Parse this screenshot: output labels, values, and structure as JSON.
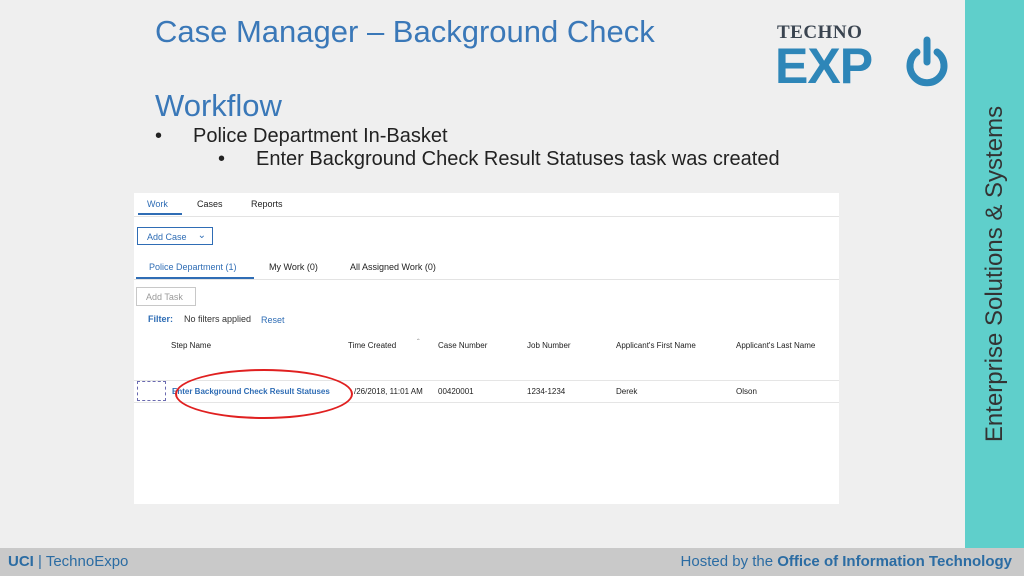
{
  "slide": {
    "title": "Case Manager – Background Check",
    "section": "Workflow",
    "bullet1": "Police Department In-Basket",
    "bullet2": "Enter Background Check Result Statuses task was created",
    "bullet_glyph": "•"
  },
  "logo": {
    "line1": "TECHNO",
    "line2": "EXP"
  },
  "sidebar": {
    "text": "Enterprise Solutions & Systems",
    "color": "#5fcfcb"
  },
  "footer": {
    "left_brand": "UCI",
    "left_sep": "|",
    "left_text": "TechnoExpo",
    "right_prefix": "Hosted by the ",
    "right_bold": "Office of Information Technology"
  },
  "app": {
    "top_tabs": [
      "Work",
      "Cases",
      "Reports"
    ],
    "add_case_label": "Add Case",
    "sub_tabs": [
      "Police Department (1)",
      "My Work (0)",
      "All Assigned Work (0)"
    ],
    "add_task_label": "Add Task",
    "filter_label": "Filter:",
    "filter_value": "No filters applied",
    "reset_label": "Reset",
    "columns": [
      "Step Name",
      "Time Created",
      "Case Number",
      "Job Number",
      "Applicant's First Name",
      "Applicant's Last Name"
    ],
    "row": {
      "step_name": "Enter Background Check Result Statuses",
      "time_created": "/26/2018, 11:01 AM",
      "case_number": "00420001",
      "job_number": "1234-1234",
      "first_name": "Derek",
      "last_name": "Olson"
    }
  },
  "colors": {
    "accent": "#2f6db5",
    "title": "#3a78b8",
    "highlight": "#e02020"
  }
}
